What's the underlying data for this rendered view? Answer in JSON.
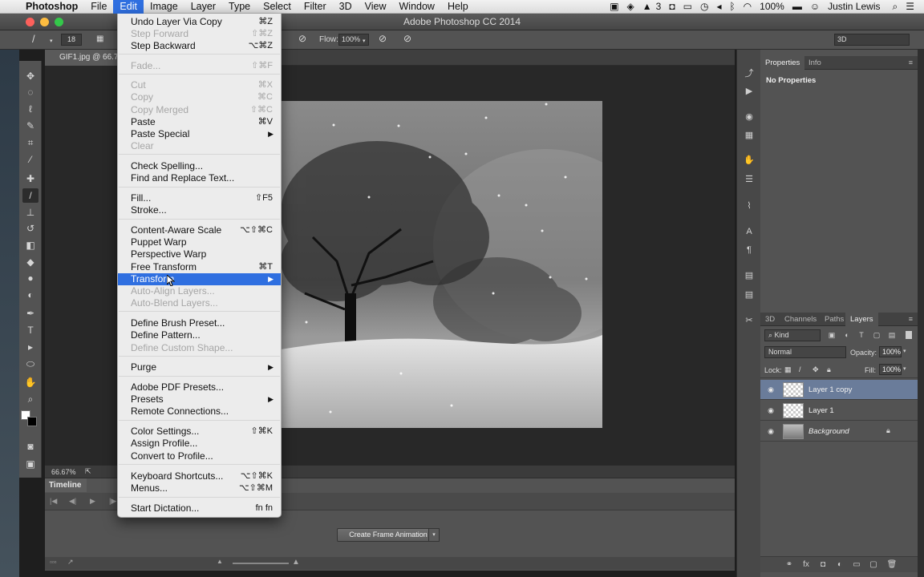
{
  "menubar": {
    "apple": "",
    "app_name": "Photoshop",
    "items": [
      "File",
      "Edit",
      "Image",
      "Layer",
      "Type",
      "Select",
      "Filter",
      "3D",
      "View",
      "Window",
      "Help"
    ],
    "status": {
      "adobe_count": "3",
      "battery": "100%",
      "user": "Justin Lewis"
    }
  },
  "window": {
    "title": "Adobe Photoshop CC 2014"
  },
  "options_bar": {
    "brush_size": "18",
    "flow_label": "Flow:",
    "flow_value": "100%",
    "workspace": "3D"
  },
  "document": {
    "tab_label": "GIF1.jpg @ 66.7",
    "zoom": "66.67%"
  },
  "timeline": {
    "tab_label": "Timeline",
    "create_button": "Create Frame Animation"
  },
  "properties": {
    "tabs": [
      "Properties",
      "Info"
    ],
    "content": "No Properties"
  },
  "layers_panel": {
    "tabs": [
      "3D",
      "Channels",
      "Paths",
      "Layers"
    ],
    "kind_filter": "Kind",
    "blend_mode": "Normal",
    "opacity_label": "Opacity:",
    "opacity_value": "100%",
    "lock_label": "Lock:",
    "fill_label": "Fill:",
    "fill_value": "100%",
    "layers": [
      {
        "name": "Layer 1 copy",
        "selected": true
      },
      {
        "name": "Layer 1",
        "selected": false
      },
      {
        "name": "Background",
        "selected": false,
        "locked": true
      }
    ]
  },
  "edit_menu": {
    "items": [
      {
        "label": "Undo Layer Via Copy",
        "shortcut": "⌘Z",
        "enabled": true
      },
      {
        "label": "Step Forward",
        "shortcut": "⇧⌘Z",
        "enabled": false
      },
      {
        "label": "Step Backward",
        "shortcut": "⌥⌘Z",
        "enabled": true
      },
      {
        "label": "Fade...",
        "shortcut": "⇧⌘F",
        "enabled": false
      },
      {
        "label": "Cut",
        "shortcut": "⌘X",
        "enabled": false
      },
      {
        "label": "Copy",
        "shortcut": "⌘C",
        "enabled": false
      },
      {
        "label": "Copy Merged",
        "shortcut": "⇧⌘C",
        "enabled": false
      },
      {
        "label": "Paste",
        "shortcut": "⌘V",
        "enabled": true
      },
      {
        "label": "Paste Special",
        "shortcut": "",
        "enabled": true,
        "submenu": true
      },
      {
        "label": "Clear",
        "shortcut": "",
        "enabled": false
      },
      {
        "label": "Check Spelling...",
        "shortcut": "",
        "enabled": true
      },
      {
        "label": "Find and Replace Text...",
        "shortcut": "",
        "enabled": true
      },
      {
        "label": "Fill...",
        "shortcut": "⇧F5",
        "enabled": true
      },
      {
        "label": "Stroke...",
        "shortcut": "",
        "enabled": true
      },
      {
        "label": "Content-Aware Scale",
        "shortcut": "⌥⇧⌘C",
        "enabled": true
      },
      {
        "label": "Puppet Warp",
        "shortcut": "",
        "enabled": true
      },
      {
        "label": "Perspective Warp",
        "shortcut": "",
        "enabled": true
      },
      {
        "label": "Free Transform",
        "shortcut": "⌘T",
        "enabled": true
      },
      {
        "label": "Transform",
        "shortcut": "",
        "enabled": true,
        "submenu": true,
        "highlighted": true
      },
      {
        "label": "Auto-Align Layers...",
        "shortcut": "",
        "enabled": false
      },
      {
        "label": "Auto-Blend Layers...",
        "shortcut": "",
        "enabled": false
      },
      {
        "label": "Define Brush Preset...",
        "shortcut": "",
        "enabled": true
      },
      {
        "label": "Define Pattern...",
        "shortcut": "",
        "enabled": true
      },
      {
        "label": "Define Custom Shape...",
        "shortcut": "",
        "enabled": false
      },
      {
        "label": "Purge",
        "shortcut": "",
        "enabled": true,
        "submenu": true
      },
      {
        "label": "Adobe PDF Presets...",
        "shortcut": "",
        "enabled": true
      },
      {
        "label": "Presets",
        "shortcut": "",
        "enabled": true,
        "submenu": true
      },
      {
        "label": "Remote Connections...",
        "shortcut": "",
        "enabled": true
      },
      {
        "label": "Color Settings...",
        "shortcut": "⇧⌘K",
        "enabled": true
      },
      {
        "label": "Assign Profile...",
        "shortcut": "",
        "enabled": true
      },
      {
        "label": "Convert to Profile...",
        "shortcut": "",
        "enabled": true
      },
      {
        "label": "Keyboard Shortcuts...",
        "shortcut": "⌥⇧⌘K",
        "enabled": true
      },
      {
        "label": "Menus...",
        "shortcut": "⌥⇧⌘M",
        "enabled": true
      },
      {
        "label": "Start Dictation...",
        "shortcut": "fn fn",
        "enabled": true
      }
    ]
  }
}
